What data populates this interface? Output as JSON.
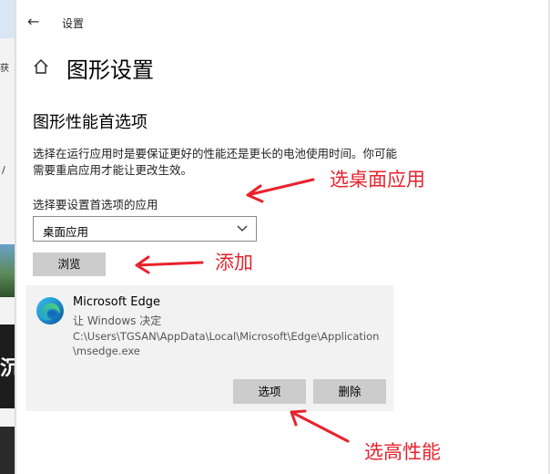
{
  "background": {
    "fragment_top": "获",
    "fragment_mid": "/",
    "fragment_img": "沉"
  },
  "titlebar": {
    "back_icon": "back-arrow-icon",
    "title": "设置"
  },
  "header": {
    "home_icon": "home-icon",
    "title": "图形设置"
  },
  "section": {
    "title": "图形性能首选项",
    "description": "选择在运行应用时是要保证更好的性能还是更长的电池使用时间。你可能需要重启应用才能让更改生效。",
    "select_label": "选择要设置首选项的应用",
    "dropdown_value": "桌面应用",
    "browse_label": "浏览"
  },
  "app_entry": {
    "name": "Microsoft Edge",
    "status": "让 Windows 决定",
    "path": "C:\\Users\\TGSAN\\AppData\\Local\\Microsoft\\Edge\\Application\\msedge.exe",
    "options_label": "选项",
    "delete_label": "删除"
  },
  "annotations": {
    "note1": "选桌面应用",
    "note2": "添加",
    "note3": "选高性能",
    "color": "#e8232d"
  }
}
